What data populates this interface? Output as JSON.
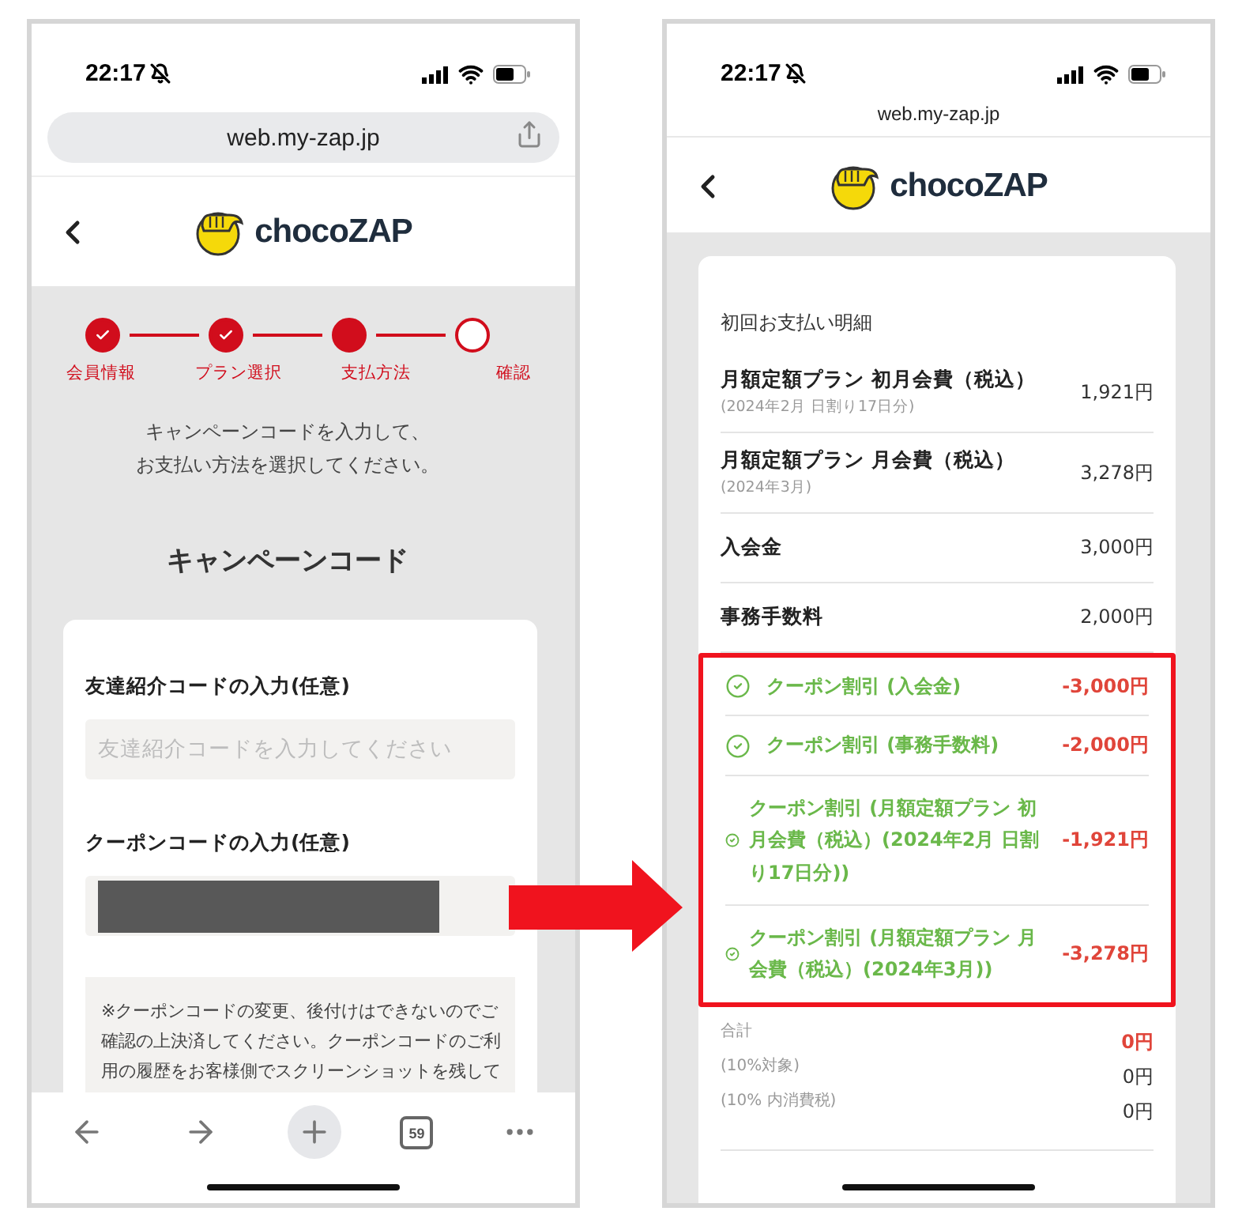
{
  "left_phone": {
    "status_bar": {
      "time": "22:17"
    },
    "address_bar": {
      "url": "web.my-zap.jp"
    },
    "header": {
      "logo": "chocoZAP"
    },
    "steps": [
      {
        "label": "会員情報",
        "completed": true,
        "current": false
      },
      {
        "label": "プラン選択",
        "completed": true,
        "current": false
      },
      {
        "label": "支払方法",
        "completed": false,
        "current": true
      },
      {
        "label": "確認",
        "completed": false,
        "current": false
      }
    ],
    "instruction_lines": [
      "キャンペーンコードを入力して、",
      "お支払い方法を選択してください。"
    ],
    "heading": "キャンペーンコード",
    "fields": [
      {
        "label": "友達紹介コードの入力(任意)",
        "placeholder": "友達紹介コードを入力してください",
        "kind": "text"
      },
      {
        "label": "クーポンコードの入力(任意)",
        "kind": "redacted"
      }
    ],
    "notice_lines": [
      "※クーポンコードの変更、後付けはできないのでご",
      "確認の上決済してください。クーポンコードのご利",
      "用の履歴をお客様側でスクリーンショットを残して"
    ],
    "toolbar": {
      "tab_count": "59"
    }
  },
  "right_phone": {
    "status_bar": {
      "time": "22:17"
    },
    "address_bar": {
      "url": "web.my-zap.jp"
    },
    "header": {
      "logo": "chocoZAP"
    },
    "section_title": "初回お支払い明細",
    "items": [
      {
        "label": "月額定額プラン 初月会費（税込）",
        "note": "(2024年2月 日割り17日分)",
        "amount": "1,921円"
      },
      {
        "label": "月額定額プラン 月会費（税込）",
        "note": "(2024年3月)",
        "amount": "3,278円"
      },
      {
        "label": "入会金",
        "amount": "3,000円"
      },
      {
        "label": "事務手数料",
        "amount": "2,000円"
      }
    ],
    "discounts": [
      {
        "label": "クーポン割引 (入会金)",
        "amount": "-3,000円",
        "compact": false
      },
      {
        "label": "クーポン割引 (事務手数料)",
        "amount": "-2,000円",
        "compact": false
      },
      {
        "label": "クーポン割引 (月額定額プラン 初月会費（税込）(2024年2月 日割り17日分))",
        "amount": "-1,921円",
        "compact": true
      },
      {
        "label": "クーポン割引 (月額定額プラン 月会費（税込）(2024年3月))",
        "amount": "-3,278円",
        "compact": true
      }
    ],
    "totals": [
      {
        "label": "合計",
        "amount": "0円",
        "emphasized": true
      },
      {
        "label": "(10%対象)",
        "amount": "0円",
        "emphasized": false
      },
      {
        "label": "(10% 内消費税)",
        "amount": "0円",
        "emphasized": false
      }
    ]
  }
}
